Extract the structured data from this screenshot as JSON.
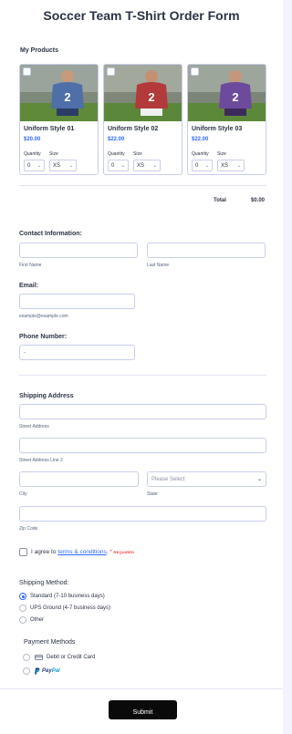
{
  "form": {
    "title": "Soccer Team T-Shirt Order Form",
    "products_label": "My Products",
    "products": [
      {
        "name": "Uniform Style 01",
        "price": "$20.00",
        "quantity_label": "Quantity",
        "quantity": "0",
        "size_label": "Size",
        "size": "XS",
        "shirt_color": "#4e6fa8"
      },
      {
        "name": "Uniform Style 02",
        "price": "$22.00",
        "quantity_label": "Quantity",
        "quantity": "0",
        "size_label": "Size",
        "size": "XS",
        "shirt_color": "#b23a3a"
      },
      {
        "name": "Uniform Style 03",
        "price": "$22.00",
        "quantity_label": "Quantity",
        "quantity": "0",
        "size_label": "Size",
        "size": "XS",
        "shirt_color": "#6c4a9c"
      }
    ],
    "total_label": "Total",
    "total_value": "$0.00",
    "contact": {
      "label": "Contact Information:",
      "first_name_sub": "First Name",
      "last_name_sub": "Last Name"
    },
    "email": {
      "label": "Email:",
      "sub": "example@example.com"
    },
    "phone": {
      "label": "Phone Number:",
      "value": "-"
    },
    "shipping_address": {
      "label": "Shipping Address",
      "street_sub": "Street Address",
      "street2_sub": "Street Address Line 2",
      "city_sub": "City",
      "state_sub": "State",
      "state_placeholder": "Please Select",
      "zip_sub": "Zip Code"
    },
    "terms": {
      "prefix": "I agree to",
      "link": "terms & conditions",
      "suffix": ".",
      "asterisk": "*",
      "required": "REQUIRED"
    },
    "shipping_method": {
      "label": "Shipping Method:",
      "options": [
        "Standard (7-10 business days)",
        "UPS Ground (4-7 business days)",
        "Other"
      ],
      "selected": 0
    },
    "payment": {
      "label": "Payment Methods",
      "card": "Debit or Credit Card",
      "paypal_a": "Pay",
      "paypal_b": "Pal"
    },
    "submit_label": "Submit"
  },
  "colors": {
    "accent": "#2e69ff",
    "submit_bg": "#0a0a0a",
    "required": "#f23a3c",
    "paypal_dark": "#253b80",
    "paypal_light": "#179bd7"
  }
}
